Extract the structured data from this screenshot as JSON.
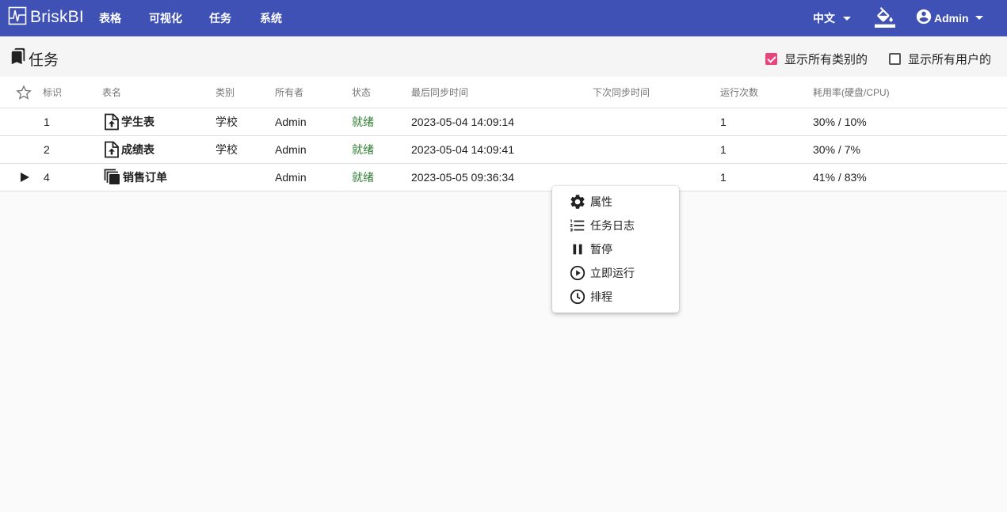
{
  "app": {
    "brand": "BriskBI"
  },
  "nav": [
    {
      "label": "表格"
    },
    {
      "label": "可视化"
    },
    {
      "label": "任务"
    },
    {
      "label": "系统"
    }
  ],
  "header": {
    "language": "中文",
    "user": "Admin",
    "icons": [
      "brand-logo-icon",
      "paint-bucket-icon",
      "account-circle-icon",
      "chevron-down-icon"
    ]
  },
  "page": {
    "title": "任务",
    "show_all_categories": {
      "label": "显示所有类别的",
      "checked": true
    },
    "show_all_users": {
      "label": "显示所有用户的",
      "checked": false
    }
  },
  "table": {
    "columns": [
      "标识",
      "表名",
      "类别",
      "所有者",
      "状态",
      "最后同步时间",
      "下次同步时间",
      "运行次数",
      "耗用率(硬盘/CPU)"
    ],
    "rows": [
      {
        "id": "1",
        "name": "学生表",
        "category": "学校",
        "owner": "Admin",
        "status": "就绪",
        "last_sync": "2023-05-04 14:09:14",
        "next_sync": "",
        "runs": "1",
        "usage": "30% / 10%",
        "icon": "file-upload-icon"
      },
      {
        "id": "2",
        "name": "成绩表",
        "category": "学校",
        "owner": "Admin",
        "status": "就绪",
        "last_sync": "2023-05-04 14:09:41",
        "next_sync": "",
        "runs": "1",
        "usage": "30% / 7%",
        "icon": "file-upload-icon"
      },
      {
        "id": "4",
        "name": "销售订单",
        "category": "",
        "owner": "Admin",
        "status": "就绪",
        "last_sync": "2023-05-05 09:36:34",
        "next_sync": "",
        "runs": "1",
        "usage": "41% / 83%",
        "icon": "copy-icon",
        "expandable": true
      }
    ]
  },
  "context_menu": [
    {
      "label": "属性",
      "icon": "gear-icon"
    },
    {
      "label": "任务日志",
      "icon": "list-numbered-icon"
    },
    {
      "label": "暂停",
      "icon": "pause-icon"
    },
    {
      "label": "立即运行",
      "icon": "play-circle-icon"
    },
    {
      "label": "排程",
      "icon": "clock-icon"
    }
  ],
  "colors": {
    "primary": "#3f51b5",
    "accent": "#e9457c",
    "status_ready": "#2e7d32"
  }
}
